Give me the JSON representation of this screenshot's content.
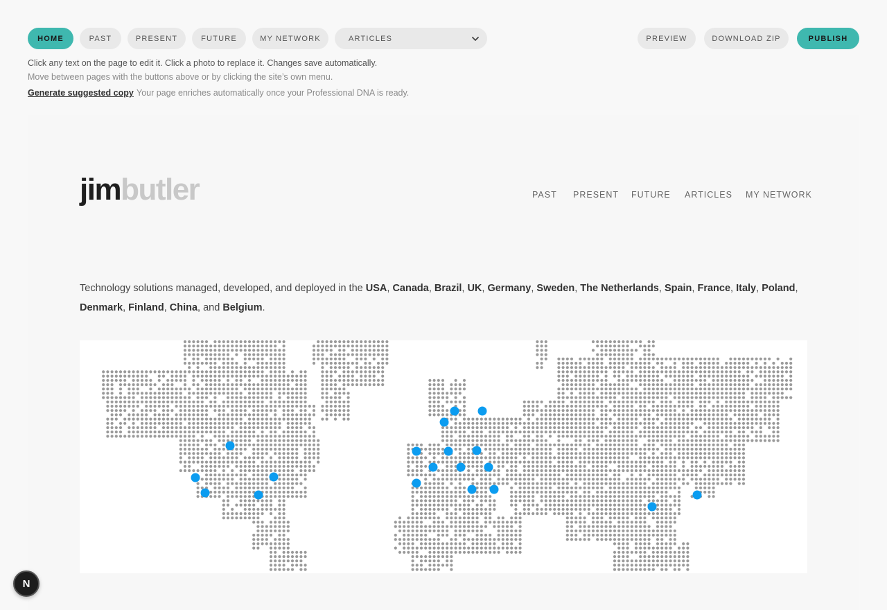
{
  "toolbar": {
    "home": "HOME",
    "past": "PAST",
    "present": "PRESENT",
    "future": "FUTURE",
    "my_network": "MY NETWORK",
    "articles_select": "ARTICLES",
    "preview": "PREVIEW",
    "download_zip": "DOWNLOAD ZIP",
    "publish": "PUBLISH",
    "accent_color": "#3fb8af"
  },
  "help": {
    "line1": "Click any text on the page to edit it. Click a photo to replace it. Changes save automatically.",
    "line2": "Move between pages with the buttons above or by clicking the site’s own menu.",
    "generate_link": "Generate suggested copy",
    "generate_note": "Your page enriches automatically once your Professional DNA is ready."
  },
  "site": {
    "logo_first": "jim",
    "logo_last": "butler",
    "nav": [
      "PAST",
      "PRESENT",
      "FUTURE",
      "ARTICLES",
      "MY NETWORK"
    ],
    "intro_prefix": "Technology solutions managed, developed, and deployed in the",
    "countries": [
      "USA",
      "Canada",
      "Brazil",
      "UK",
      "Germany",
      "Sweden",
      "The Netherlands",
      "Spain",
      "France",
      "Italy",
      "Poland",
      "Denmark",
      "Finland",
      "China",
      "Belgium"
    ],
    "marker_color": "#0b9cf0",
    "dot_color": "#9a9a9a"
  },
  "badge": {
    "label": "N"
  }
}
